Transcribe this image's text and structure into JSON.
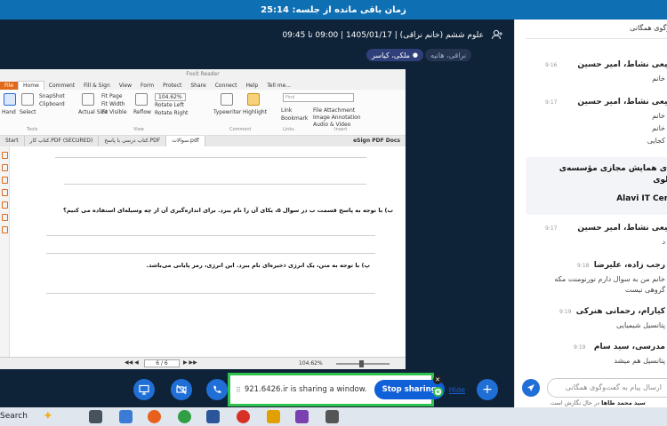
{
  "topbar": {
    "timer_text": "زمان باقی مانده از جلسه: 25:14"
  },
  "meeting": {
    "title": "علوم ششم (خانم نراقی) | 1405/01/17 | 09:00 تا 09:45",
    "chips": [
      "ملکی، کیاسر",
      "نراقی، هانیه"
    ]
  },
  "pdf": {
    "window_title": "Foxit Reader",
    "menu_tabs": [
      "File",
      "Home",
      "Comment",
      "Fill & Sign",
      "View",
      "Form",
      "Protect",
      "Share",
      "Connect",
      "Help",
      "Tell me..."
    ],
    "ribbon": {
      "hand": "Hand",
      "select": "Select",
      "snapshot": "SnapShot",
      "clipboard": "Clipboard",
      "actual_size": "Actual Size",
      "fit_page": "Fit Page",
      "fit_width": "Fit Width",
      "fit_visible": "Fit Visible",
      "reflow": "Reflow",
      "zoom": "104.62%",
      "rotate_left": "Rotate Left",
      "rotate_right": "Rotate Right",
      "typewriter": "Typewriter",
      "highlight": "Highlight",
      "link": "Link",
      "bookmark": "Bookmark",
      "file_attachment": "File Attachment",
      "image_annotation": "Image Annotation",
      "audio_video": "Audio & Video",
      "find_placeholder": "Find",
      "groups": [
        "Tools",
        "View",
        "Comment",
        "Links",
        "Insert"
      ]
    },
    "doc_tabs": [
      "Start",
      "کتاب کار.PDF (SECURED)",
      "کتاب درسی با پاسخ.PDF",
      "سوالات.pdf"
    ],
    "esign": "eSign PDF Docs",
    "question_b": "ب) با توجه به پاسخ قسمت ب در سوال ۵، یکای آن را نام ببرد. برای اندازه‌گیری آن از چه وسیله‌ای استفاده می کنیم؟",
    "question_p": "پ) با توجه به متن، یک انرژی ذخیره‌ای نام ببرد. این انرژی، رمز پایانی می‌باشد.",
    "page_indicator": "6 / 6",
    "zoom_status": "104.62%"
  },
  "share": {
    "message": "921.6426.ir is sharing a window.",
    "stop_label": "Stop sharing",
    "hide_label": "Hide"
  },
  "chat": {
    "header": "گفت‌وگوی همگانی",
    "messages": [
      {
        "name": "شفیعی نشاط، امیر حسین",
        "time": "9:16",
        "lines": [
          "خانم"
        ]
      },
      {
        "name": "شفیعی نشاط، امیر حسین",
        "time": "9:17",
        "lines": [
          "خانم",
          "خانم",
          "کجایی"
        ]
      },
      {
        "name": "شفیعی نشاط، امیر حسین",
        "time": "9:17",
        "lines": [
          "د"
        ]
      },
      {
        "name": "رجب زاده، علیرضا",
        "time": "9:18",
        "lines": [
          "خانم من به سوال دارم نورنومنت مکه",
          "گروهی نیست"
        ]
      },
      {
        "name": "کیارام، رحمانی هنرکی",
        "time": "9:19",
        "lines": [
          "پتانسیل شیمیایی"
        ]
      },
      {
        "name": "مدرسی، سید سام",
        "time": "9:19",
        "lines": [
          "پتانسیل هم میشد"
        ]
      }
    ],
    "notice_lines": [
      "سامانه‌ی همایش مجازی مؤسسه‌ی",
      "علوی",
      "Alavi IT Center"
    ],
    "input_placeholder": "ارسال پیام به گفت‌وگوی همگانی",
    "typing_name": "سید محمد طاها",
    "typing_suffix": "در حال نگارش است"
  },
  "taskbar": {
    "search_label": "Search"
  },
  "colors": {
    "accent": "#1f6fd6",
    "share_border": "#2fc24c",
    "topbar": "#0f6fb3"
  }
}
